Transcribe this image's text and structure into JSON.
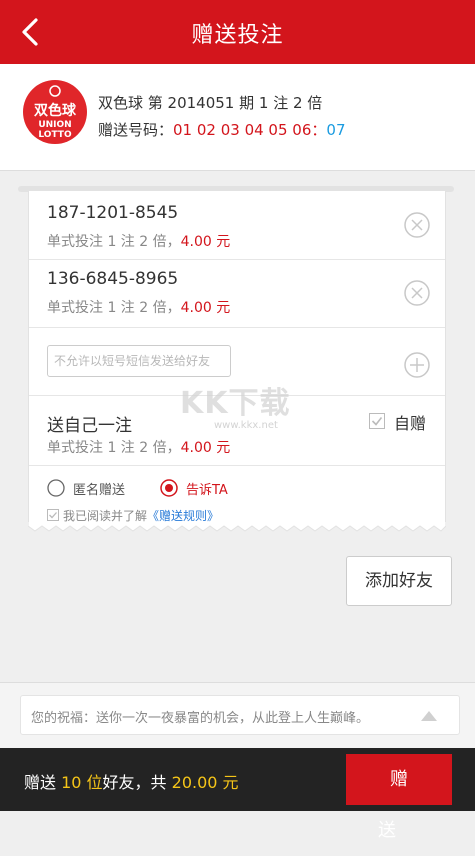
{
  "header": {
    "title": "赠送投注"
  },
  "lottery": {
    "logo_text_top": "双色球",
    "logo_text_bottom_1": "UNION",
    "logo_text_bottom_2": "LOTTO",
    "line1": "双色球 第 2014051 期  1 注 2 倍",
    "numbers_label": "赠送号码：",
    "red_numbers": "01 02 03 04 05 06",
    "separator": "：",
    "blue_number": "07"
  },
  "recipients": [
    {
      "phone": "187-1201-8545",
      "bet_prefix": "单式投注 1 注 2 倍，",
      "amount": "4.00 元"
    },
    {
      "phone": "136-6845-8965",
      "bet_prefix": "单式投注 1 注 2 倍，",
      "amount": "4.00 元"
    }
  ],
  "message_input": {
    "placeholder": "不允许以短号短信发送给好友"
  },
  "self_gift": {
    "title": "送自己一注",
    "bet_prefix": "单式投注 1 注 2 倍，",
    "amount": "4.00 元",
    "checkbox_label": "自赠"
  },
  "options": {
    "anonymous_label": "匿名赠送",
    "tell_label": "告诉TA",
    "agree_prefix": "我已阅读并了解",
    "agree_link": "《赠送规则》"
  },
  "add_friend_button": "添加好友",
  "watermark": {
    "text": "KK下载",
    "url": "www.kkx.net"
  },
  "wish": {
    "text": "您的祝福：送你一次一夜暴富的机会，从此登上人生巅峰。"
  },
  "footer": {
    "prefix": "赠送 ",
    "count": "10 位",
    "middle": "好友，共 ",
    "total": "20.00 元",
    "button": "赠送"
  },
  "colors": {
    "brand_red": "#d3151c",
    "blue_ball": "#1a9be0",
    "highlight_yellow": "#f5c518",
    "footer_bg": "#232323"
  }
}
